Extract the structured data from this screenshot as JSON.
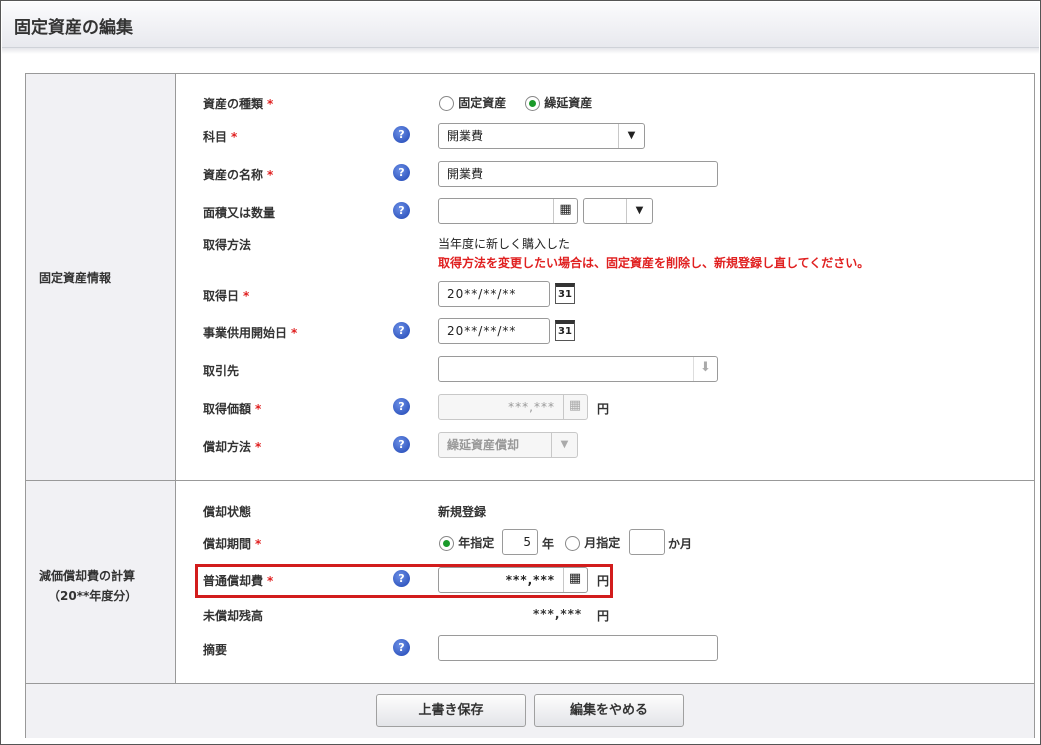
{
  "header": {
    "title": "固定資産の編集"
  },
  "sections": {
    "asset_info": "固定資産情報",
    "calc_line1": "減価償却費の計算",
    "calc_line2": "（20**年度分）"
  },
  "fields": {
    "asset_type": {
      "label": "資産の種類",
      "opt1": "固定資産",
      "opt2": "繰延資産",
      "selected": "繰延資産"
    },
    "account": {
      "label": "科目",
      "value": "開業費"
    },
    "asset_name": {
      "label": "資産の名称",
      "value": "開業費"
    },
    "area": {
      "label": "面積又は数量",
      "value": "",
      "unit": ""
    },
    "acq_method": {
      "label": "取得方法",
      "value": "当年度に新しく購入した",
      "note": "取得方法を変更したい場合は、固定資産を削除し、新規登録し直してください。"
    },
    "acq_date": {
      "label": "取得日",
      "value": "20**/**/**"
    },
    "service_date": {
      "label": "事業供用開始日",
      "value": "20**/**/**"
    },
    "client": {
      "label": "取引先",
      "value": ""
    },
    "acq_price": {
      "label": "取得価額",
      "value": "***,***",
      "unit": "円"
    },
    "dep_method": {
      "label": "償却方法",
      "value": "繰延資産償却"
    },
    "dep_status": {
      "label": "償却状態",
      "value": "新規登録"
    },
    "dep_period": {
      "label": "償却期間",
      "opt_year": "年指定",
      "year_value": "5",
      "year_unit": "年",
      "opt_month": "月指定",
      "month_value": "",
      "month_unit": "か月",
      "selected": "年指定"
    },
    "normal_dep": {
      "label": "普通償却費",
      "value": "***,***",
      "unit": "円"
    },
    "undep_balance": {
      "label": "未償却残高",
      "value": "***,***",
      "unit": "円"
    },
    "summary": {
      "label": "摘要",
      "value": ""
    }
  },
  "required_mark": "*",
  "help_mark": "?",
  "buttons": {
    "save": "上書き保存",
    "cancel": "編集をやめる"
  }
}
